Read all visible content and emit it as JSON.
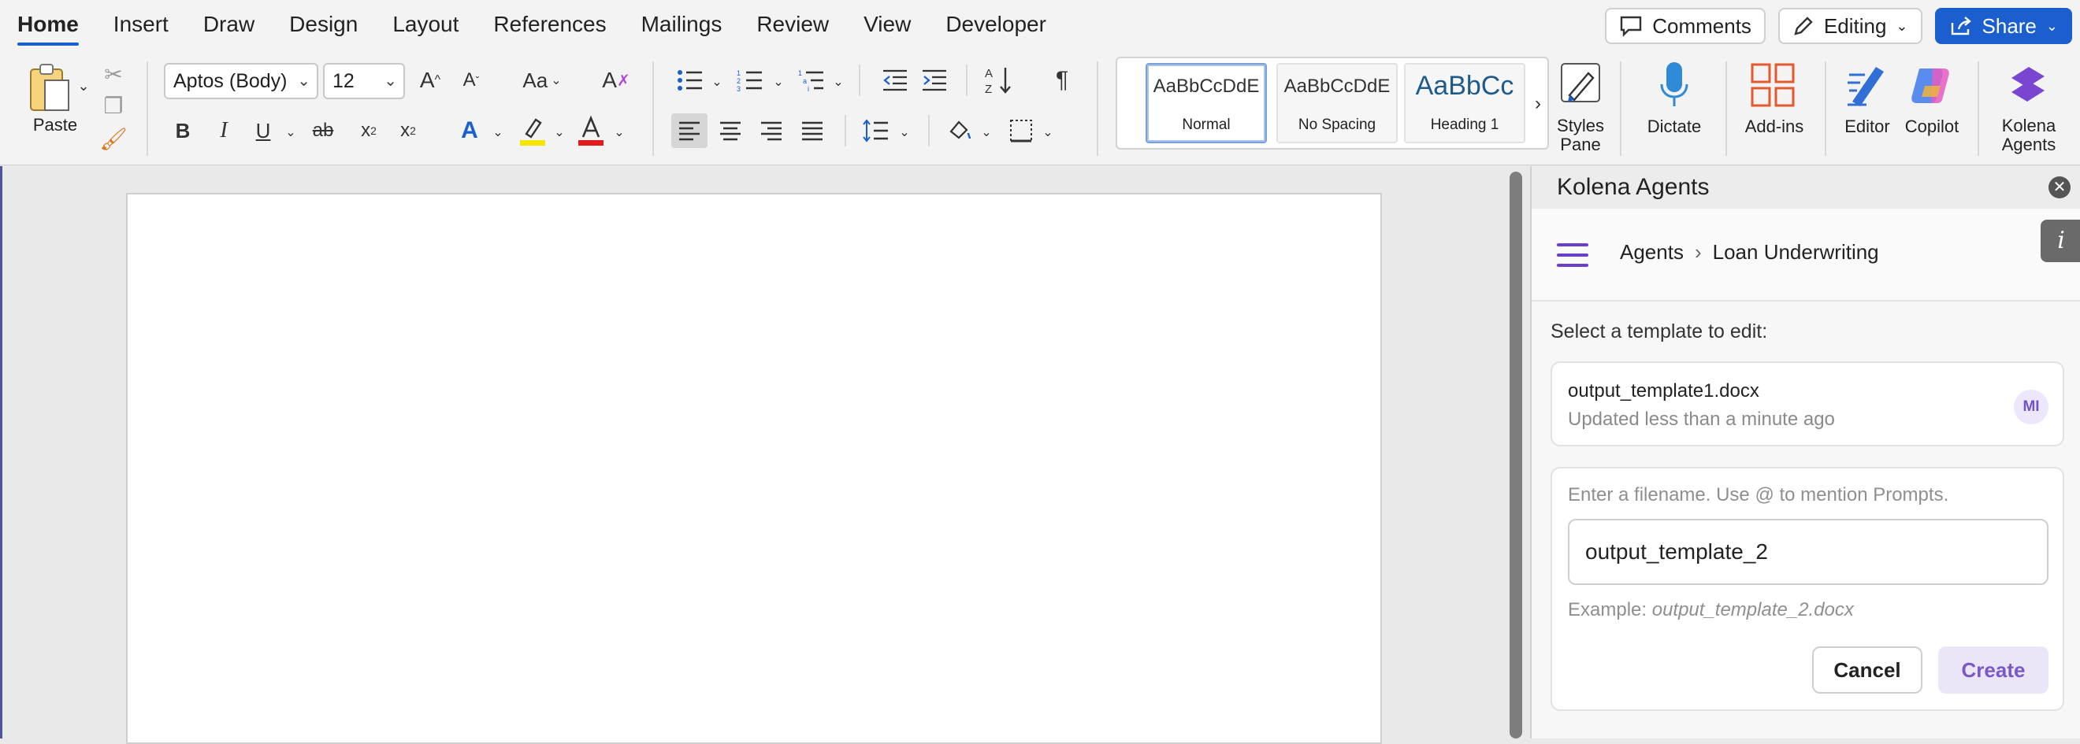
{
  "ribbon": {
    "tabs": [
      {
        "label": "Home",
        "active": true
      },
      {
        "label": "Insert"
      },
      {
        "label": "Draw"
      },
      {
        "label": "Design"
      },
      {
        "label": "Layout"
      },
      {
        "label": "References"
      },
      {
        "label": "Mailings"
      },
      {
        "label": "Review"
      },
      {
        "label": "View"
      },
      {
        "label": "Developer"
      }
    ],
    "actions": {
      "comments": "Comments",
      "editing": "Editing",
      "share": "Share"
    },
    "clipboard": {
      "paste": "Paste"
    },
    "font": {
      "family": "Aptos (Body)",
      "size": "12"
    },
    "styles": [
      {
        "sample": "AaBbCcDdE",
        "name": "Normal"
      },
      {
        "sample": "AaBbCcDdE",
        "name": "No Spacing"
      },
      {
        "sample": "AaBbCc",
        "name": "Heading 1"
      }
    ],
    "styles_pane": {
      "line1": "Styles",
      "line2": "Pane"
    },
    "dictate": "Dictate",
    "addins": "Add-ins",
    "editor": "Editor",
    "copilot": "Copilot",
    "kolena": {
      "line1": "Kolena",
      "line2": "Agents"
    },
    "colors": {
      "accent": "#1b5fcf",
      "highlight": "#f5e500",
      "font_color": "#e11b1b"
    }
  },
  "pane": {
    "title": "Kolena Agents",
    "breadcrumb": {
      "root": "Agents",
      "current": "Loan Underwriting"
    },
    "select_label": "Select a template to edit:",
    "template": {
      "file": "output_template1.docx",
      "updated": "Updated less than a minute ago",
      "badge": "MI"
    },
    "form": {
      "hint": "Enter a filename. Use @ to mention Prompts.",
      "value": "output_template_2",
      "example_prefix": "Example:",
      "example_value": "output_template_2.docx",
      "cancel": "Cancel",
      "create": "Create"
    }
  }
}
